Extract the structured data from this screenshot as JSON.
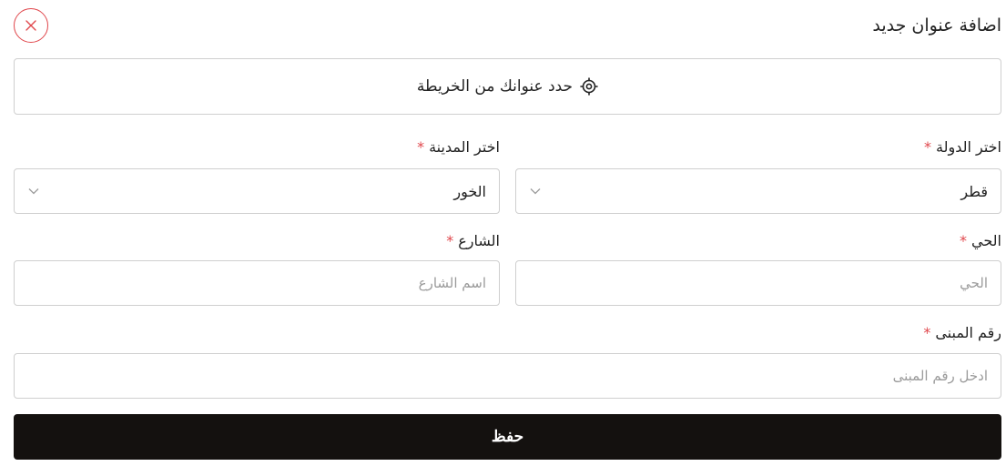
{
  "header": {
    "title": "اضافة عنوان جديد",
    "close_icon": "close-icon"
  },
  "map": {
    "label": "حدد عنوانك من الخريطة",
    "icon": "location-target-icon"
  },
  "form": {
    "required_mark": "*",
    "country": {
      "label": "اختر الدولة",
      "value": "قطر"
    },
    "city": {
      "label": "اختر المدينة",
      "value": "الخور"
    },
    "district": {
      "label": "الحي",
      "placeholder": "الحي"
    },
    "street": {
      "label": "الشارع",
      "placeholder": "اسم الشارع"
    },
    "building": {
      "label": "رقم المبنى",
      "placeholder": "ادخل رقم المبنى"
    }
  },
  "save": {
    "label": "حفظ"
  },
  "colors": {
    "accent": "#e0474c",
    "button": "#14110f",
    "border": "#cfcfcf"
  }
}
